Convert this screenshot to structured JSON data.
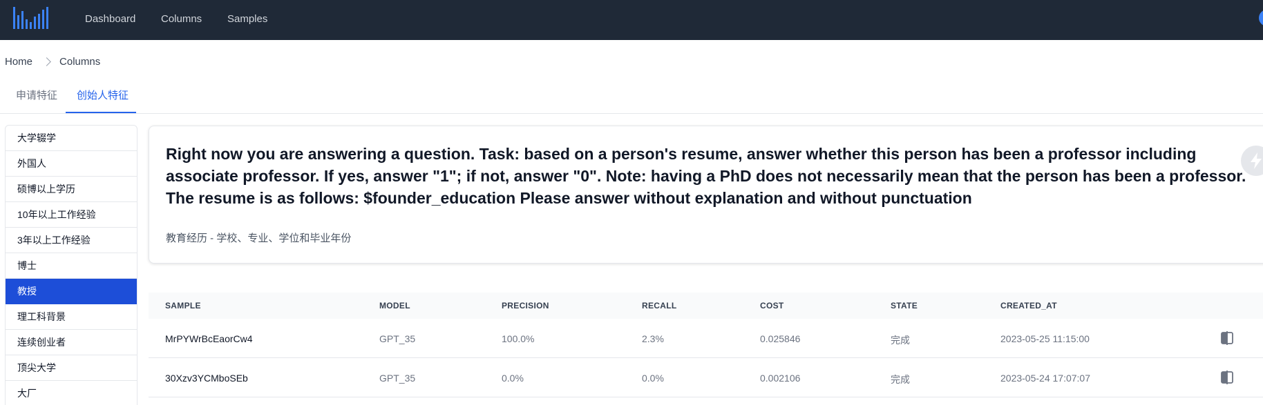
{
  "nav": {
    "items": [
      "Dashboard",
      "Columns",
      "Samples"
    ],
    "logo_icon": "bar-chart-logo-icon",
    "accent": "#2563eb",
    "bar_color": "#1f2937"
  },
  "breadcrumb": [
    "Home",
    "Columns"
  ],
  "tabs": [
    "申请特征",
    "创始人特征"
  ],
  "active_tab": "创始人特征",
  "sidebar": {
    "items": [
      "大学辍学",
      "外国人",
      "硕博以上学历",
      "10年以上工作经验",
      "3年以上工作经验",
      "博士",
      "教授",
      "理工科背景",
      "连续创业者",
      "顶尖大学",
      "大厂"
    ],
    "active": "教授"
  },
  "card": {
    "prompt": "Right now you are answering a question. Task: based on a person's resume, answer whether this person has been a professor including associate professor. If yes, answer \"1\"; if not, answer \"0\". Note: having a PhD does not necessarily mean that the person has been a professor. The resume is as follows: $founder_education Please answer without explanation and without punctuation",
    "subtitle": "教育经历 - 学校、专业、学位和毕业年份",
    "action_icon": "lightning-icon"
  },
  "table": {
    "headers": [
      "SAMPLE",
      "MODEL",
      "PRECISION",
      "RECALL",
      "COST",
      "STATE",
      "CREATED_AT"
    ],
    "rows": [
      {
        "sample": "MrPYWrBcEaorCw4",
        "model": "GPT_35",
        "precision": "100.0%",
        "recall": "2.3%",
        "cost": "0.025846",
        "state": "完成",
        "created_at": "2023-05-25 11:15:00",
        "action_icon": "compare-icon"
      },
      {
        "sample": "30Xzv3YCMboSEb",
        "model": "GPT_35",
        "precision": "0.0%",
        "recall": "0.0%",
        "cost": "0.002106",
        "state": "完成",
        "created_at": "2023-05-24 17:07:07",
        "action_icon": "compare-icon"
      }
    ]
  }
}
